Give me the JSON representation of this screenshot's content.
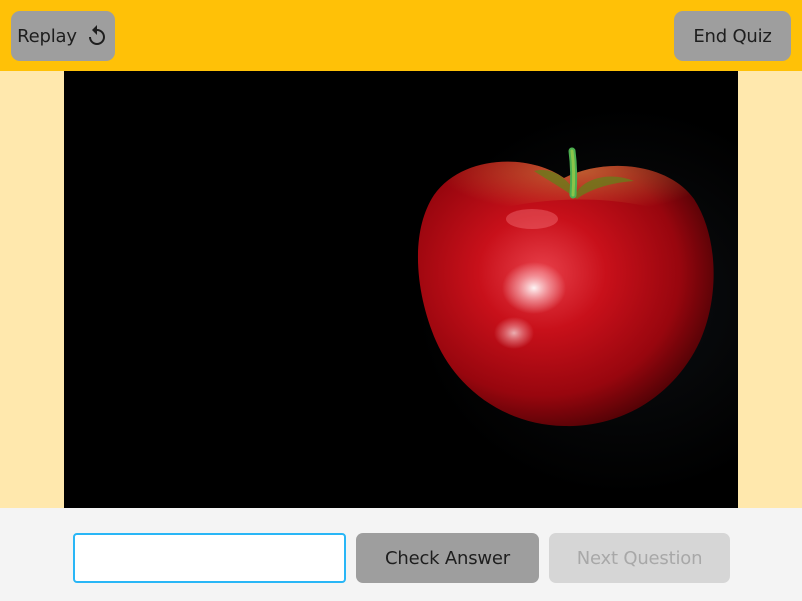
{
  "header": {
    "replay_label": "Replay",
    "end_label": "End Quiz"
  },
  "stage": {
    "image_subject": "apple"
  },
  "footer": {
    "answer_value": "",
    "answer_placeholder": "",
    "check_label": "Check Answer",
    "next_label": "Next Question"
  },
  "colors": {
    "topbar": "#ffc107",
    "page_bg": "#ffe8ad",
    "button_gray": "#9e9e9e",
    "button_disabled": "#d6d6d6",
    "input_border": "#29b6f6",
    "apple_red": "#c8101a"
  },
  "icons": {
    "replay": "replay-icon"
  }
}
